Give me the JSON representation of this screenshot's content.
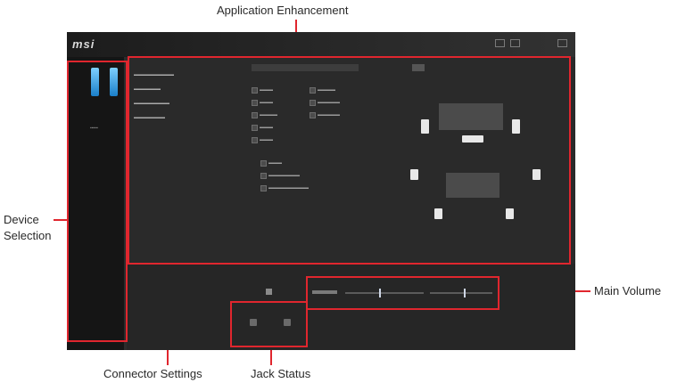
{
  "callouts": {
    "application_enhancement": "Application Enhancement",
    "device_selection": "Device\nSelection",
    "main_volume": "Main Volume",
    "connector_settings": "Connector Settings",
    "jack_status": "Jack Status"
  },
  "app": {
    "logo": "msi"
  },
  "colors": {
    "callout_red": "#e0262e",
    "window_bg": "#2c2c2c",
    "sidebar_bg": "#151515"
  },
  "main_volume": {
    "level": 0.55
  }
}
